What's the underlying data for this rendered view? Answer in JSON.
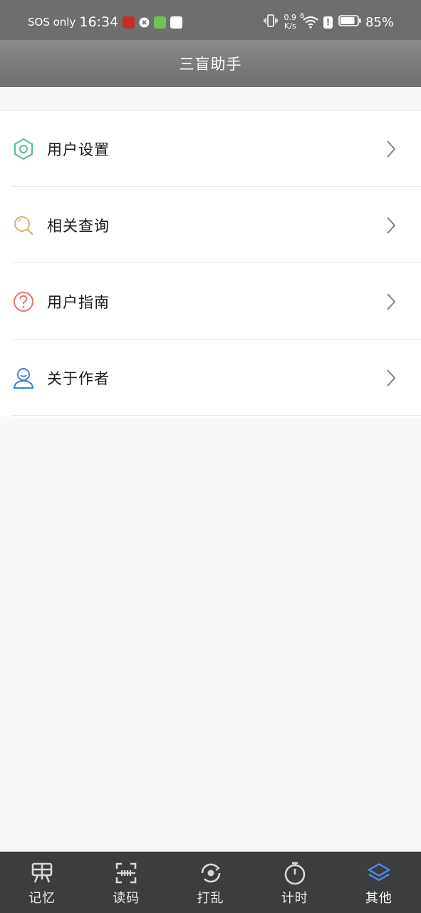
{
  "status_bar": {
    "carrier": "SOS only",
    "time": "16:34",
    "net_speed_value": "0.9",
    "net_speed_unit": "K/s",
    "wifi_badge": "6",
    "battery": "85%",
    "battery_level": 0.85
  },
  "header": {
    "title": "三盲助手"
  },
  "menu": {
    "items": [
      {
        "label": "用户设置",
        "icon": "hexagon-settings-icon",
        "color": "#5cb99a"
      },
      {
        "label": "相关查询",
        "icon": "magnifier-icon",
        "color": "#d8b36a"
      },
      {
        "label": "用户指南",
        "icon": "question-circle-icon",
        "color": "#e2776b"
      },
      {
        "label": "关于作者",
        "icon": "user-icon",
        "color": "#3d7fd8"
      }
    ]
  },
  "bottom_nav": {
    "active_index": 4,
    "active_color": "#4a8cf5",
    "items": [
      {
        "label": "记忆",
        "icon": "memory-icon"
      },
      {
        "label": "读码",
        "icon": "scan-code-icon"
      },
      {
        "label": "打乱",
        "icon": "scramble-icon"
      },
      {
        "label": "计时",
        "icon": "timer-icon"
      },
      {
        "label": "其他",
        "icon": "layers-icon"
      }
    ]
  }
}
